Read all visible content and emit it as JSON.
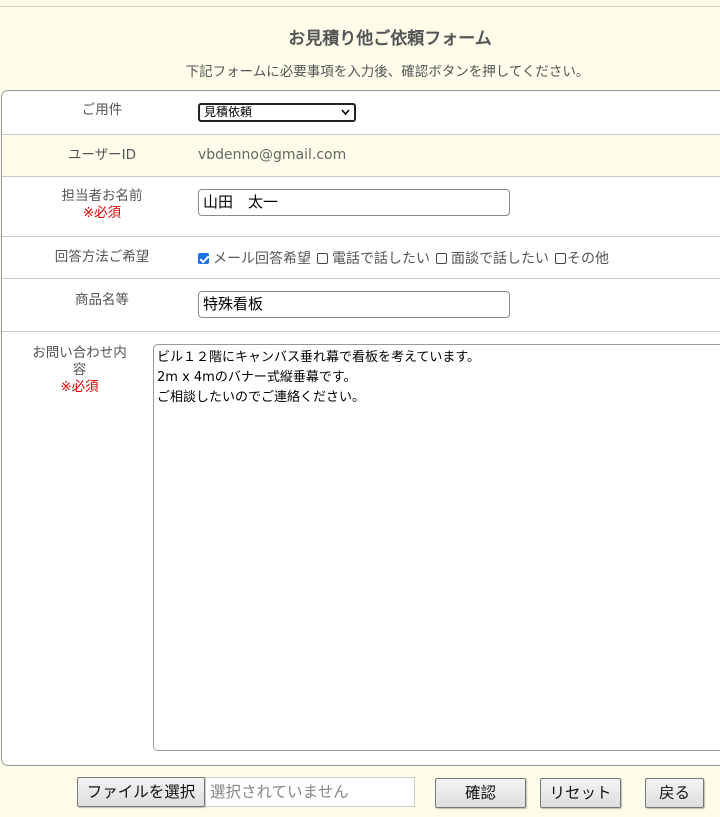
{
  "header": {
    "title": "お見積り他ご依頼フォーム",
    "subtitle": "下記フォームに必要事項を入力後、確認ボタンを押してください。"
  },
  "form": {
    "purpose": {
      "label": "ご用件",
      "selected": "見積依頼"
    },
    "user_id": {
      "label": "ユーザーID",
      "value": "vbdenno@gmail.com"
    },
    "name": {
      "label": "担当者お名前",
      "required": "※必須",
      "value": "山田　太一"
    },
    "reply_method": {
      "label": "回答方法ご希望",
      "options": [
        {
          "label": "メール回答希望",
          "checked": true
        },
        {
          "label": "電話で話したい",
          "checked": false
        },
        {
          "label": "面談で話したい",
          "checked": false
        },
        {
          "label": "その他",
          "checked": false
        }
      ]
    },
    "product": {
      "label": "商品名等",
      "value": "特殊看板"
    },
    "inquiry": {
      "label": "お問い合わせ内容",
      "required": "※必須",
      "value": "ビル１２階にキャンバス垂れ幕で看板を考えています。\n2m x 4mのバナー式縦垂幕です。\nご相談したいのでご連絡ください。"
    }
  },
  "footer": {
    "file_button": "ファイルを選択",
    "file_status": "選択されていません",
    "confirm_button": "確認",
    "reset_button": "リセット",
    "back_button": "戻る"
  },
  "colors": {
    "page_bg": "#fdfdea",
    "required": "#e00000",
    "checkbox_checked": "#1a73e8"
  }
}
